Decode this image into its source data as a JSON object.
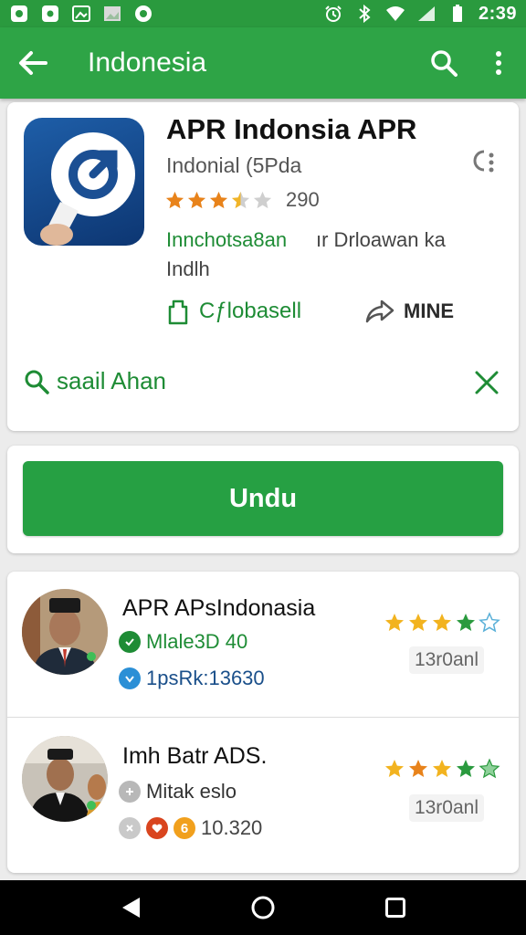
{
  "status_bar": {
    "time": "2:39",
    "left_icons": [
      "app-notification-icon",
      "app-notification-icon",
      "image-notification-icon",
      "gallery-notification-icon",
      "app-notification-icon"
    ],
    "right_icons": [
      "alarm-icon",
      "bluetooth-icon",
      "wifi-icon",
      "signal-icon",
      "battery-icon"
    ]
  },
  "app_bar": {
    "title": "Indonesia",
    "color": "#2ea446"
  },
  "app_card": {
    "name": "APR Indonsia APR",
    "developer": "Indonial (5Pda",
    "rating_stars": 3.5,
    "rating_count": "290",
    "category_green": "Innchotsa8an",
    "category_gray": "ır Drloawan ka",
    "category_line2": "Indlh",
    "action_primary": "Cƒlobasell",
    "action_secondary": "MINE",
    "search_label": "saail Ahan"
  },
  "primary_button": {
    "label": "Undu",
    "color": "#26a043"
  },
  "list": [
    {
      "title": "APR APsIndonasia",
      "meta1": "Mlale3D 40",
      "meta2": "1psRk:13630",
      "stars": 4,
      "badge": "13r0anl"
    },
    {
      "title": "Imh Batr ADS.",
      "meta1": "Mitak eslo",
      "meta2": "10.320",
      "stars": 4,
      "badge": "13r0anl"
    }
  ],
  "nav_bar": {
    "icons": [
      "back-nav-icon",
      "home-nav-icon",
      "recents-nav-icon"
    ]
  }
}
